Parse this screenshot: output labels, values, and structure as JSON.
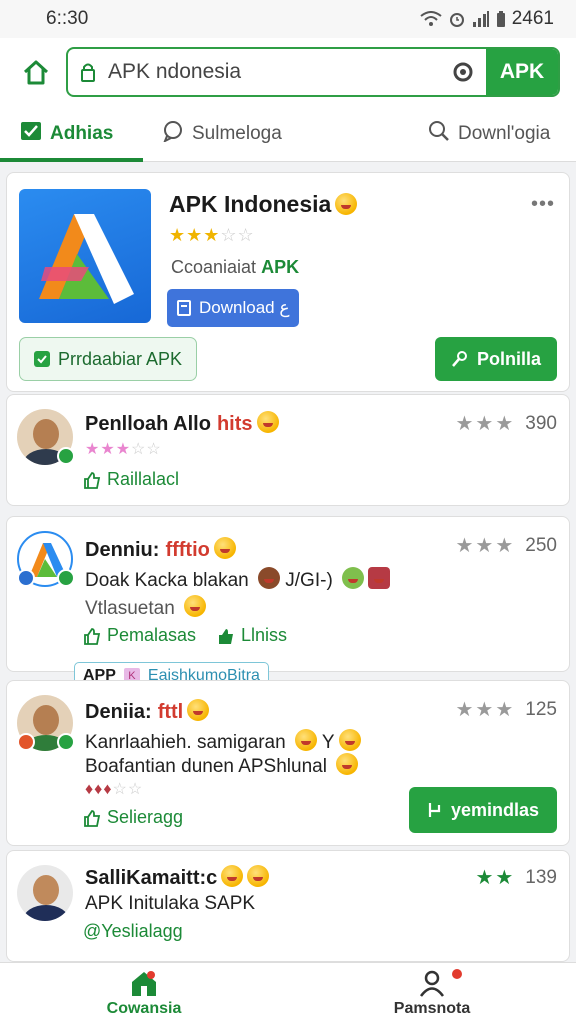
{
  "status": {
    "time": "6::30",
    "battery": "2461"
  },
  "search": {
    "value": "APK ndonesia",
    "button": "APK"
  },
  "tabs": [
    {
      "label": "Adhias"
    },
    {
      "label": "Sulmeloga"
    },
    {
      "label": "Downl'ogia"
    }
  ],
  "hero": {
    "title": "APK Indonesia",
    "rating": 3,
    "rating_max": 5,
    "sub_prefix": "Ccoaniaiat",
    "sub_accent": "APK",
    "download_label": "Download ع",
    "pill_label": "Prrdaabiar APK",
    "popular_label": "Polnilla"
  },
  "reviews": [
    {
      "name": "Penlloah Allo",
      "highlight": "hits",
      "count": "390",
      "action": "Raillalacl"
    },
    {
      "name": "Denniu:",
      "highlight": "ffftio",
      "count": "250",
      "text": "Doak Kacka blakan",
      "text2": "J/GI-)",
      "subtext": "Vtlasuetan",
      "action1": "Pemalasas",
      "action2": "Llniss"
    },
    {
      "name": "Deniia:",
      "highlight": "fttl",
      "count": "125",
      "text": "Kanrlaahieh. samigaran",
      "text_suffix": "Y",
      "text2": "Boafantian dunen APShlunal",
      "action": "Selieragg",
      "button": "yemindlas"
    },
    {
      "name": "SalliKamaitt:c",
      "count": "139",
      "text": "APK Initulaka SAPK",
      "action": "@Yeslialagg"
    }
  ],
  "tag": {
    "prefix": "APP",
    "label": "EaishkumoBitra"
  },
  "bottom_nav": [
    {
      "label": "Cowansia"
    },
    {
      "label": "Pamsnota"
    }
  ],
  "colors": {
    "accent": "#27a242",
    "download": "#3f74db",
    "highlight": "#d23b2f"
  }
}
